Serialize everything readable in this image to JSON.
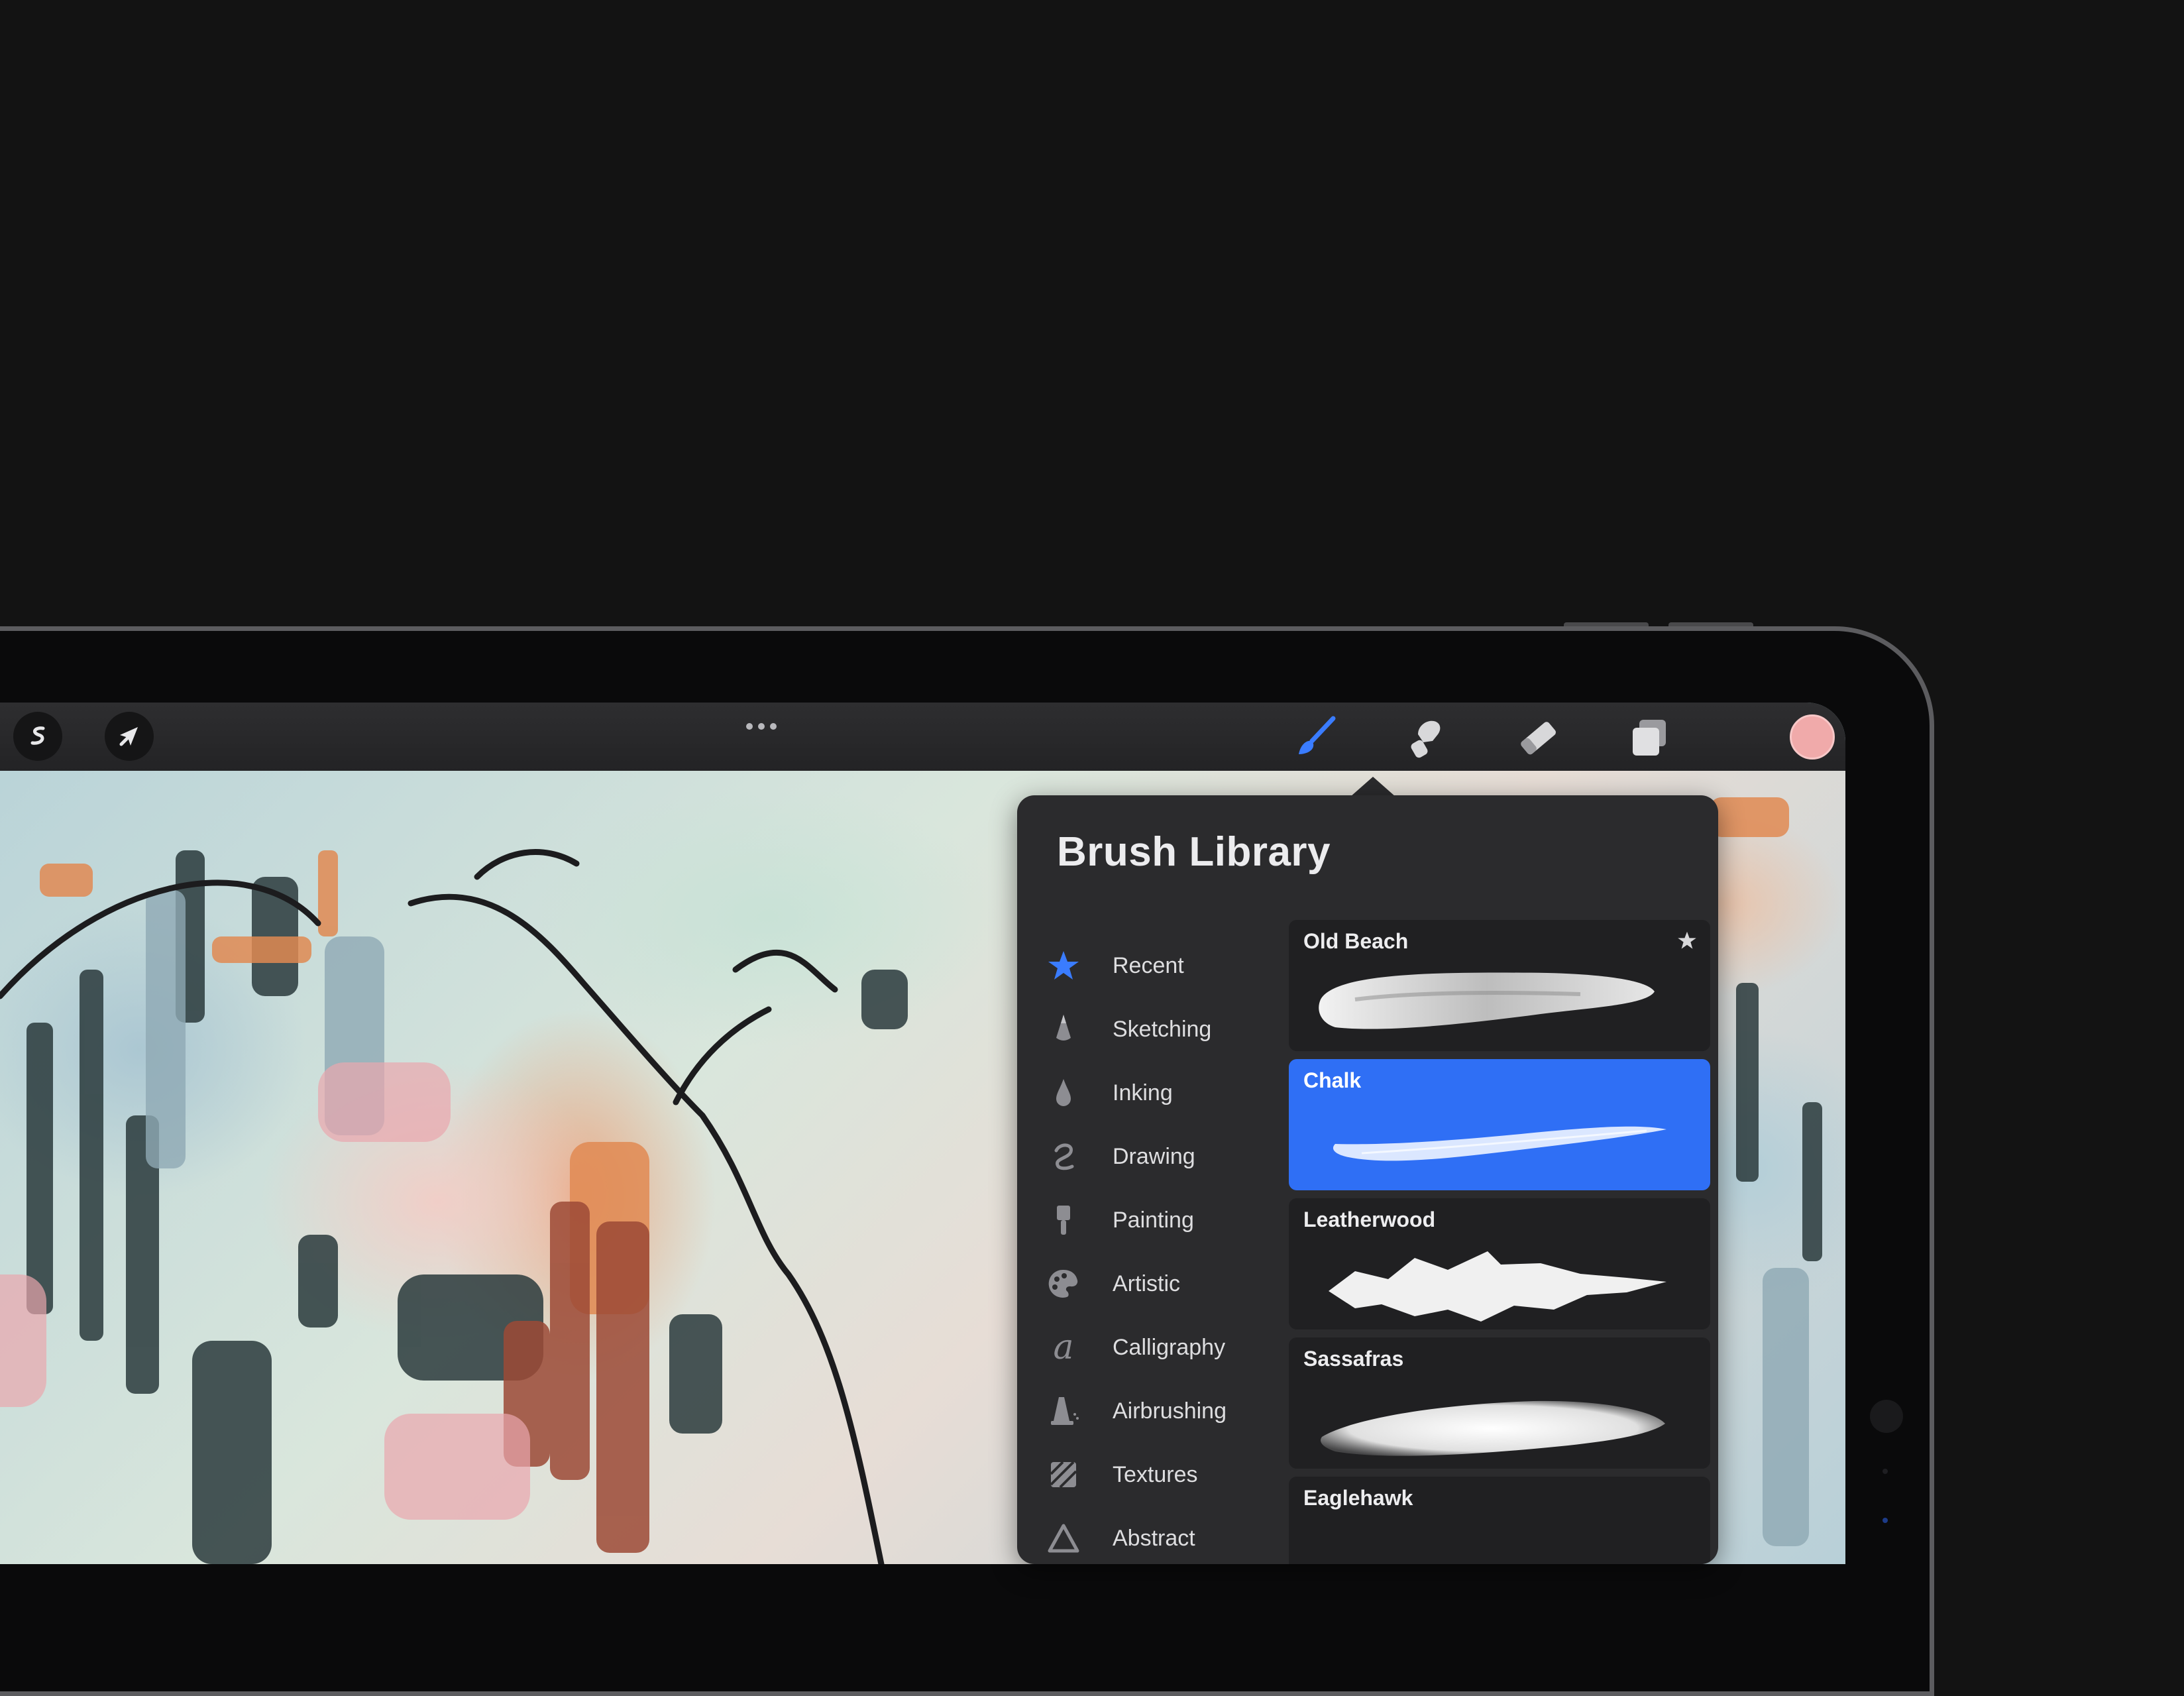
{
  "toolbar": {
    "left_buttons": [
      "adjustments-icon",
      "selection-icon"
    ],
    "more_icon": "ellipsis-icon",
    "tools": [
      "brush-icon",
      "smudge-icon",
      "eraser-icon",
      "layers-icon"
    ],
    "active_tool": "brush-icon",
    "current_color": "#f0aaaa"
  },
  "library": {
    "title": "Brush Library",
    "categories": [
      {
        "label": "Recent",
        "icon": "star-icon",
        "active": true
      },
      {
        "label": "Sketching",
        "icon": "pencil-tip-icon"
      },
      {
        "label": "Inking",
        "icon": "ink-drop-icon"
      },
      {
        "label": "Drawing",
        "icon": "squiggle-icon"
      },
      {
        "label": "Painting",
        "icon": "paint-brush-icon"
      },
      {
        "label": "Artistic",
        "icon": "palette-icon"
      },
      {
        "label": "Calligraphy",
        "icon": "calligraphy-a-icon"
      },
      {
        "label": "Airbrushing",
        "icon": "airbrush-icon"
      },
      {
        "label": "Textures",
        "icon": "texture-icon"
      },
      {
        "label": "Abstract",
        "icon": "triangle-icon"
      }
    ],
    "brushes": [
      {
        "name": "Old Beach",
        "starred": true,
        "selected": false
      },
      {
        "name": "Chalk",
        "starred": false,
        "selected": true
      },
      {
        "name": "Leatherwood",
        "starred": false,
        "selected": false
      },
      {
        "name": "Sassafras",
        "starred": false,
        "selected": false
      },
      {
        "name": "Eaglehawk",
        "starred": false,
        "selected": false
      }
    ]
  },
  "colors": {
    "accent": "#2f6ff5",
    "panel": "#2b2b2d",
    "card": "#202022"
  }
}
